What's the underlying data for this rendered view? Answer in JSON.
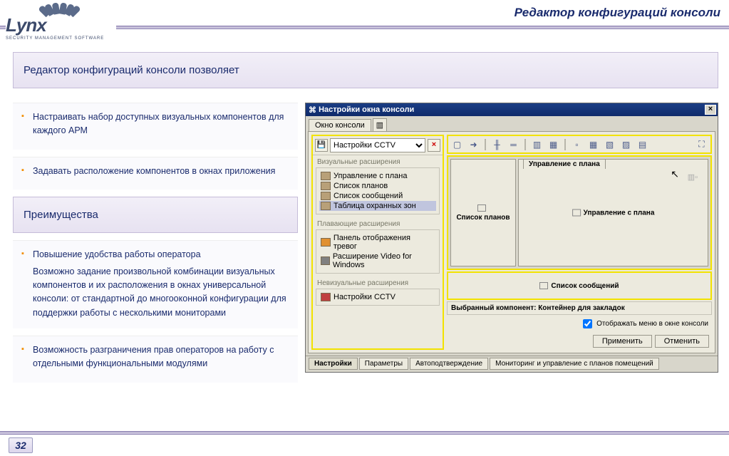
{
  "header": {
    "title": "Редактор конфигураций консоли"
  },
  "logo": {
    "name": "Lynx",
    "sub": "SECURITY MANAGEMENT SOFTWARE"
  },
  "intro_panel": "Редактор конфигураций консоли позволяет",
  "features": [
    "Настраивать набор доступных визуальных компонентов для каждого АРМ",
    "Задавать расположение компонентов в окнах приложения"
  ],
  "advantages_title": "Преимущества",
  "advantages": [
    {
      "title": "Повышение удобства работы оператора",
      "desc": "Возможно задание произвольной комбинации визуальных компонентов и их расположения в окнах универсальной консоли: от стандартной до многооконной конфигурации для поддержки работы с несколькими мониторами"
    },
    {
      "title": "Возможность разграничения прав операторов на работу с отдельными функциональными модулями",
      "desc": ""
    }
  ],
  "app": {
    "title": "Настройки окна консоли",
    "top_tabs": [
      "Окно консоли"
    ],
    "dropdown": "Настройки CCTV",
    "groups": {
      "visual": {
        "label": "Визуальные расширения",
        "items": [
          "Управление с плана",
          "Список планов",
          "Список сообщений",
          "Таблица охранных зон"
        ]
      },
      "floating": {
        "label": "Плавающие расширения",
        "items": [
          "Панель отображения тревог",
          "Расширение Video for Windows"
        ]
      },
      "nonvisual": {
        "label": "Невизуальные расширения",
        "items": [
          "Настройки CCTV"
        ]
      }
    },
    "layout": {
      "left_pane": "Список планов",
      "tab_label": "Управление с плана",
      "center_label": "Управление с плана",
      "msg_pane": "Список сообщений"
    },
    "status": "Выбранный компонент: Контейнер для закладок",
    "checkbox": "Отображать меню в окне консоли",
    "buttons": {
      "apply": "Применить",
      "cancel": "Отменить"
    },
    "bottom_tabs": [
      "Настройки",
      "Параметры",
      "Автоподтверждение",
      "Мониторинг и управление с планов помещений"
    ]
  },
  "page_number": "32"
}
